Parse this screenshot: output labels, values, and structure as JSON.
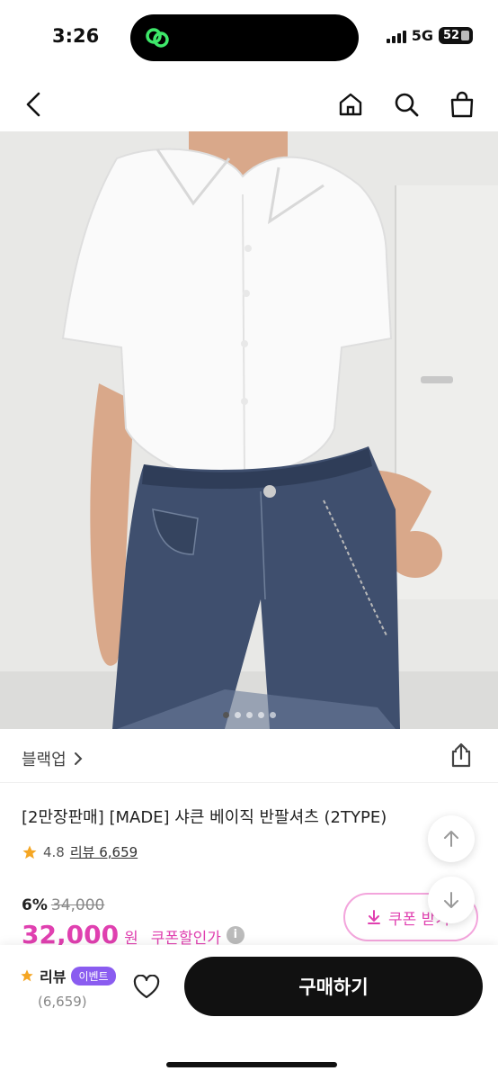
{
  "status": {
    "time": "3:26",
    "network": "5G",
    "battery": "52"
  },
  "category": {
    "label": "블랙업"
  },
  "product": {
    "title": "[2만장판매] [MADE] 샤큰 베이직 반팔셔츠 (2TYPE)",
    "rating": "4.8",
    "reviews_label": "리뷰 6,659",
    "discount": "6%",
    "original_price": "34,000",
    "price": "32,000",
    "currency": "원",
    "coupon_price_label": "쿠폰할인가",
    "info": "i",
    "image_indicator": {
      "count": 5,
      "active_index": 0
    }
  },
  "coupon_button": {
    "label": "쿠폰 받기"
  },
  "bottom_bar": {
    "review_label": "리뷰",
    "event_badge": "이벤트",
    "review_count": "(6,659)",
    "buy_label": "구매하기"
  },
  "colors": {
    "accent": "#e040b0",
    "badge": "#8a5cf0",
    "star": "#f5a623",
    "buy_button": "#111111"
  },
  "icons": {
    "back": "chevron-left-icon",
    "home": "home-icon",
    "search": "search-icon",
    "bag": "shopping-bag-icon",
    "share": "share-icon",
    "heart": "heart-icon",
    "download": "download-icon"
  }
}
